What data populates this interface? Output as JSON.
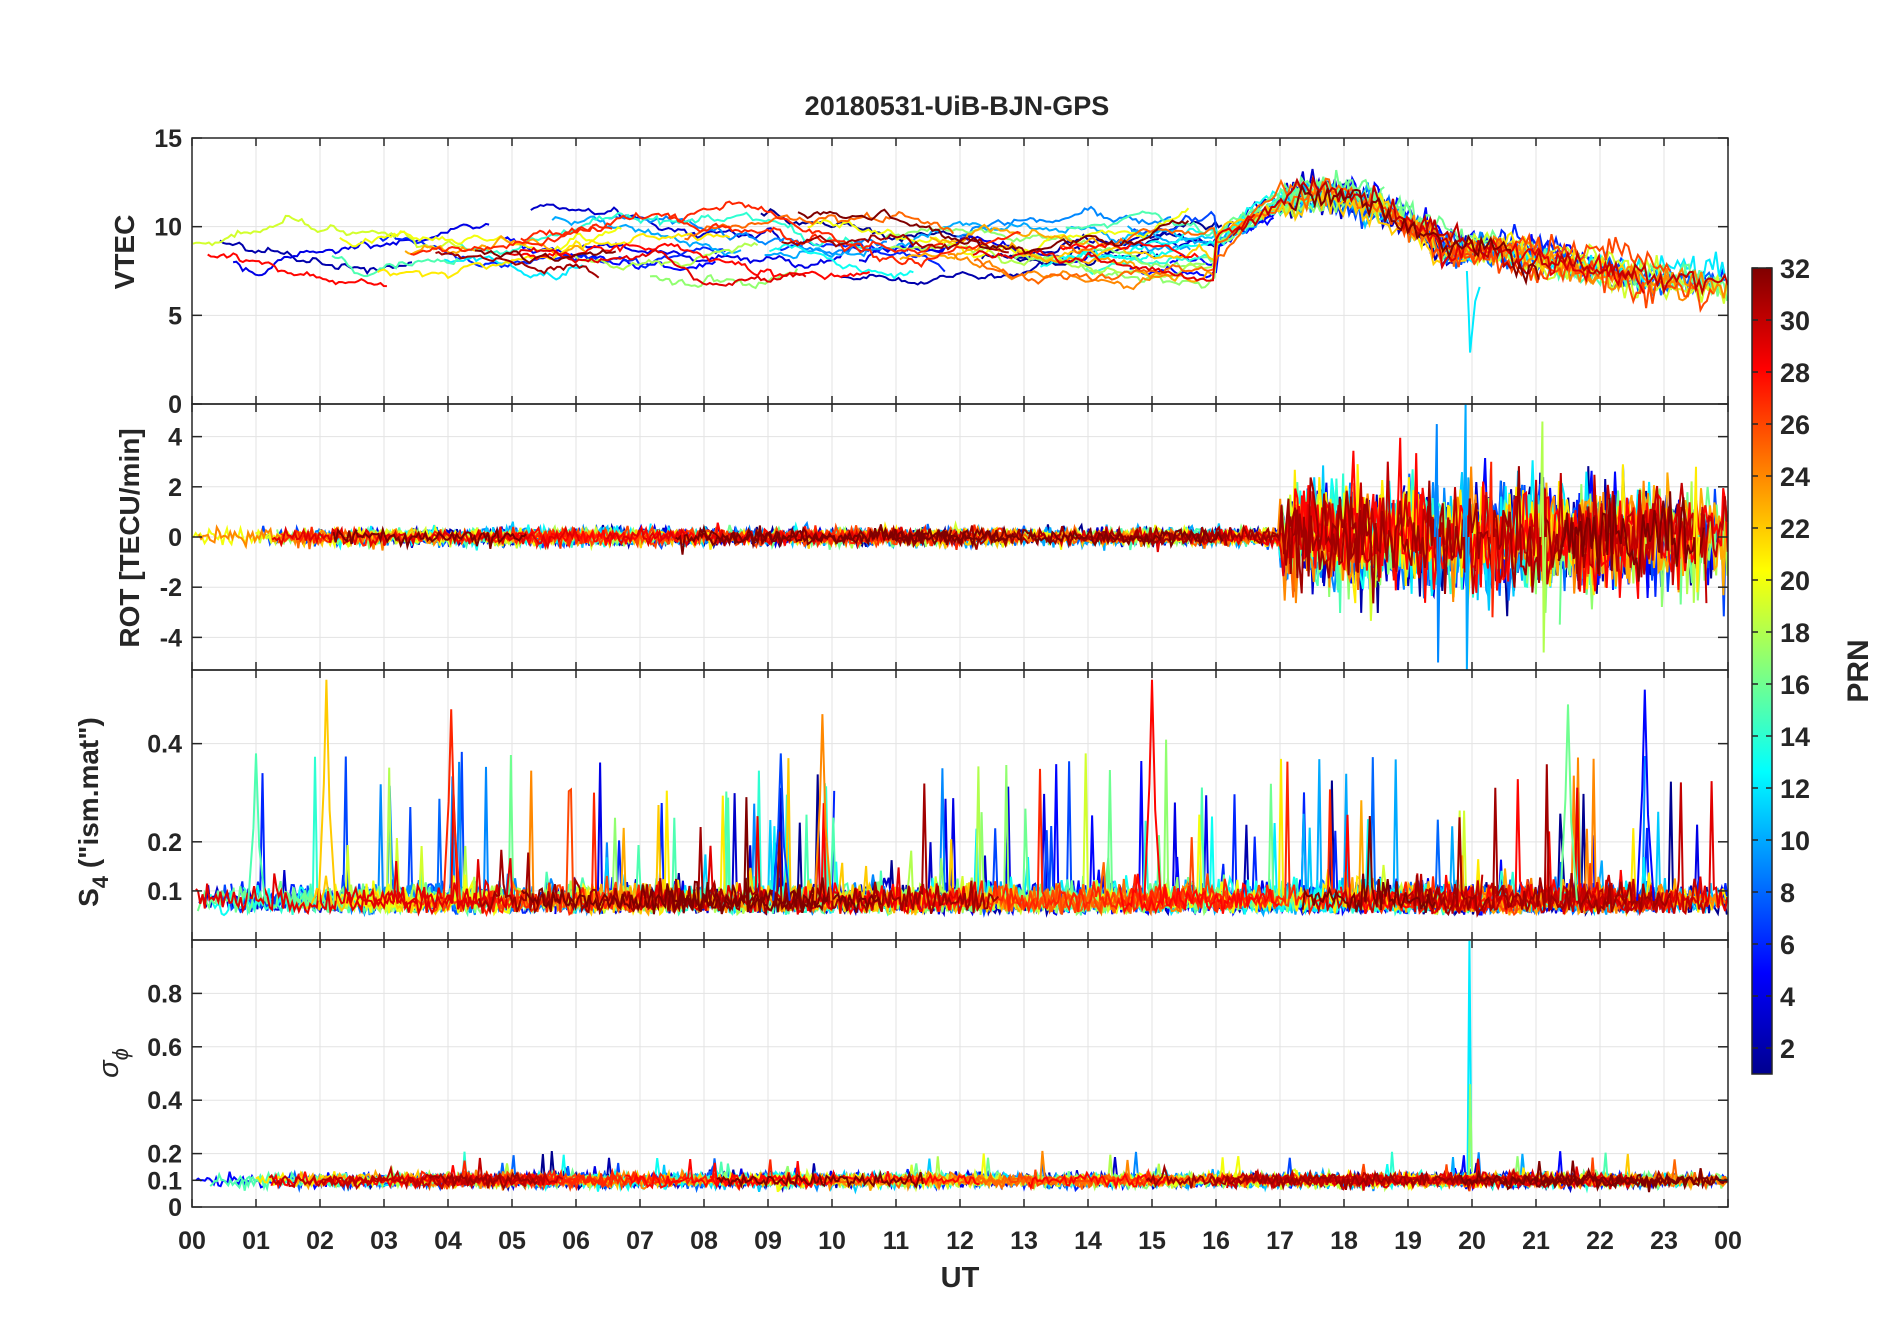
{
  "figure_title": "20180531-UiB-BJN-GPS",
  "x_axis": {
    "label": "UT",
    "tick_labels": [
      "00",
      "01",
      "02",
      "03",
      "04",
      "05",
      "06",
      "07",
      "08",
      "09",
      "10",
      "11",
      "12",
      "13",
      "14",
      "15",
      "16",
      "17",
      "18",
      "19",
      "20",
      "21",
      "22",
      "23",
      "00"
    ]
  },
  "colorbar": {
    "label": "PRN",
    "min": 1,
    "max": 32,
    "ticks": [
      2,
      4,
      6,
      8,
      10,
      12,
      14,
      16,
      18,
      20,
      22,
      24,
      26,
      28,
      30,
      32
    ],
    "colormap": "jet",
    "colors": [
      "#00008f",
      "#0000ff",
      "#0080ff",
      "#00ffff",
      "#80ff80",
      "#ffff00",
      "#ff8000",
      "#ff0000",
      "#800000"
    ]
  },
  "chart_data": [
    {
      "type": "line",
      "panel": "vtec",
      "ylabel": "VTEC",
      "xlim": [
        0,
        24
      ],
      "ylim": [
        0,
        15
      ],
      "yticks": [
        0,
        5,
        10,
        15
      ],
      "ytick_labels": [
        "0",
        "5",
        "10",
        "15"
      ],
      "grid": true,
      "series_by": "PRN",
      "series_count": 32,
      "series_values": {
        "night_level": [
          7.5,
          10
        ],
        "afternoon_level": [
          8,
          13
        ],
        "late_evening_level": [
          5,
          9
        ]
      },
      "annotations": {
        "dropout_at_20UT": 2.9
      }
    },
    {
      "type": "line",
      "panel": "rot",
      "ylabel": "ROT [TECU/min]",
      "xlim": [
        0,
        24
      ],
      "ylim": [
        -5.3,
        5.3
      ],
      "yticks": [
        -4,
        -2,
        0,
        2,
        4
      ],
      "ytick_labels": [
        "-4",
        "-2",
        "0",
        "2",
        "4"
      ],
      "grid": true,
      "series_by": "PRN",
      "series_count": 32,
      "series_values": {
        "quiet_amplitude": 0.4,
        "active_amplitude_17_24UT": 2.5,
        "peak_near_20UT": 5.3
      }
    },
    {
      "type": "line",
      "panel": "s4",
      "ylabel_main": "S",
      "ylabel_sub": "4",
      "ylabel_rest": " (\"ism.mat\")",
      "xlim": [
        0,
        24
      ],
      "ylim": [
        0,
        0.55
      ],
      "yticks": [
        0.1,
        0.2,
        0.4
      ],
      "ytick_labels": [
        "0.1",
        "0.2",
        "0.4"
      ],
      "grid": true,
      "series_by": "PRN",
      "series_count": 32,
      "series_values": {
        "baseline": [
          0.05,
          0.1
        ],
        "spike_peak_max": 0.53
      }
    },
    {
      "type": "line",
      "panel": "sigma_phi",
      "ylabel_main": "σ",
      "ylabel_sub": "ϕ",
      "xlim": [
        0,
        24
      ],
      "ylim": [
        0,
        1
      ],
      "yticks": [
        0,
        0.1,
        0.2,
        0.4,
        0.6,
        0.8
      ],
      "ytick_labels": [
        "0",
        "0.1",
        "0.2",
        "0.4",
        "0.6",
        "0.8"
      ],
      "grid": true,
      "series_by": "PRN",
      "series_count": 32,
      "series_values": {
        "baseline": 0.1,
        "peak_near_20UT": 1.0
      }
    }
  ]
}
